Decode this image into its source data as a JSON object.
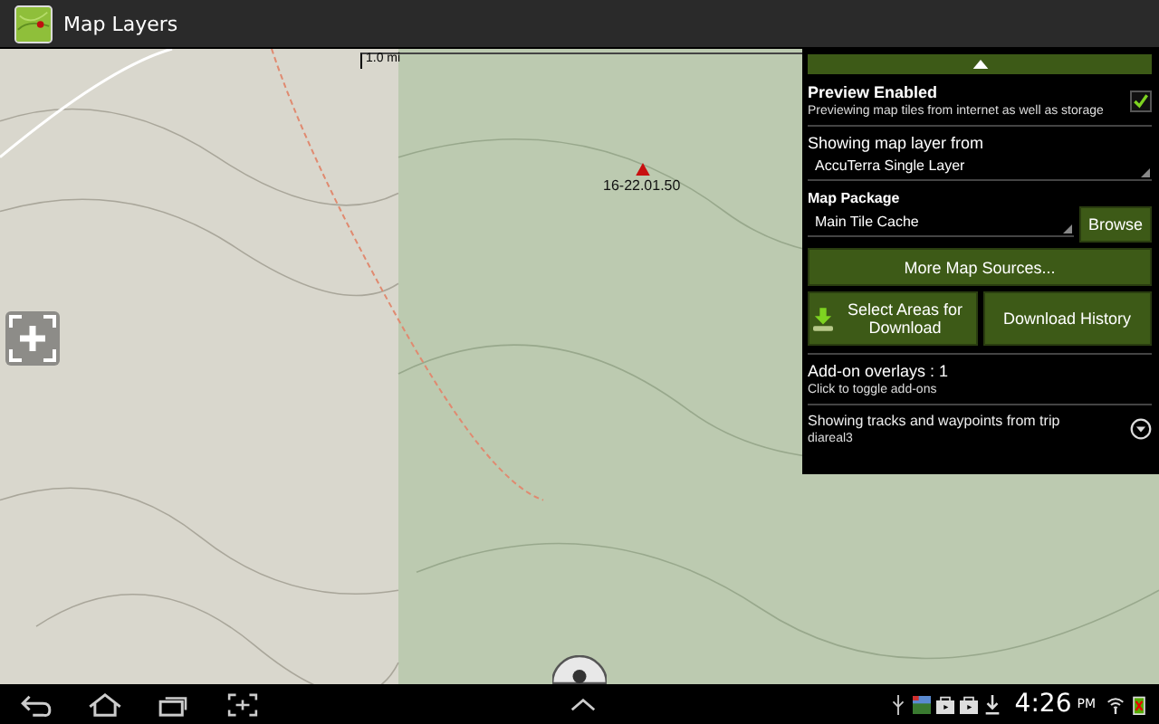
{
  "window": {
    "title": "Map Layers"
  },
  "map": {
    "scale_label": "1.0 mi",
    "waypoint_label": "16-22.01.50"
  },
  "layers_panel": {
    "preview": {
      "label": "Preview Enabled",
      "description": "Previewing map tiles from internet as well as storage",
      "checked": true
    },
    "layer_source": {
      "label": "Showing map layer from",
      "value": "AccuTerra Single Layer"
    },
    "map_package": {
      "label": "Map Package",
      "value": "Main Tile Cache",
      "button": "Browse"
    },
    "more_sources_button": "More Map Sources...",
    "select_areas_button": "Select Areas for Download",
    "download_history_button": "Download History",
    "overlays": {
      "title": "Add-on overlays : 1",
      "hint": "Click to toggle add-ons"
    },
    "trip": {
      "title": "Showing tracks and waypoints from trip",
      "name": "diareal3"
    }
  },
  "status_bar": {
    "time": "4:26",
    "meridiem": "PM"
  }
}
